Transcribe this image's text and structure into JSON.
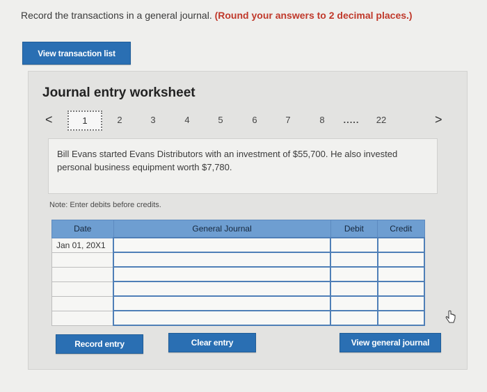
{
  "instruction": {
    "text": "Record the transactions in a general journal. ",
    "bold": "(Round your answers to 2 decimal places.)"
  },
  "buttons": {
    "view_transaction_list": "View transaction list",
    "record_entry": "Record entry",
    "clear_entry": "Clear entry",
    "view_general_journal": "View general journal"
  },
  "worksheet": {
    "title": "Journal entry worksheet",
    "pager": {
      "prev": "<",
      "next": ">",
      "current": "1",
      "pages": [
        "2",
        "3",
        "4",
        "5",
        "6",
        "7",
        "8"
      ],
      "ellipsis": ".....",
      "last": "22"
    },
    "description": "Bill Evans started Evans Distributors with an investment of $55,700. He also invested personal business equipment worth $7,780.",
    "note": "Note: Enter debits before credits.",
    "table": {
      "headers": [
        "Date",
        "General Journal",
        "Debit",
        "Credit"
      ],
      "rows": [
        {
          "date": "Jan 01, 20X1"
        },
        {
          "date": ""
        },
        {
          "date": ""
        },
        {
          "date": ""
        },
        {
          "date": ""
        },
        {
          "date": ""
        }
      ]
    }
  },
  "colors": {
    "button_blue": "#2a6fb3",
    "header_blue": "#6e9ed1",
    "instruction_red": "#c0392b"
  }
}
